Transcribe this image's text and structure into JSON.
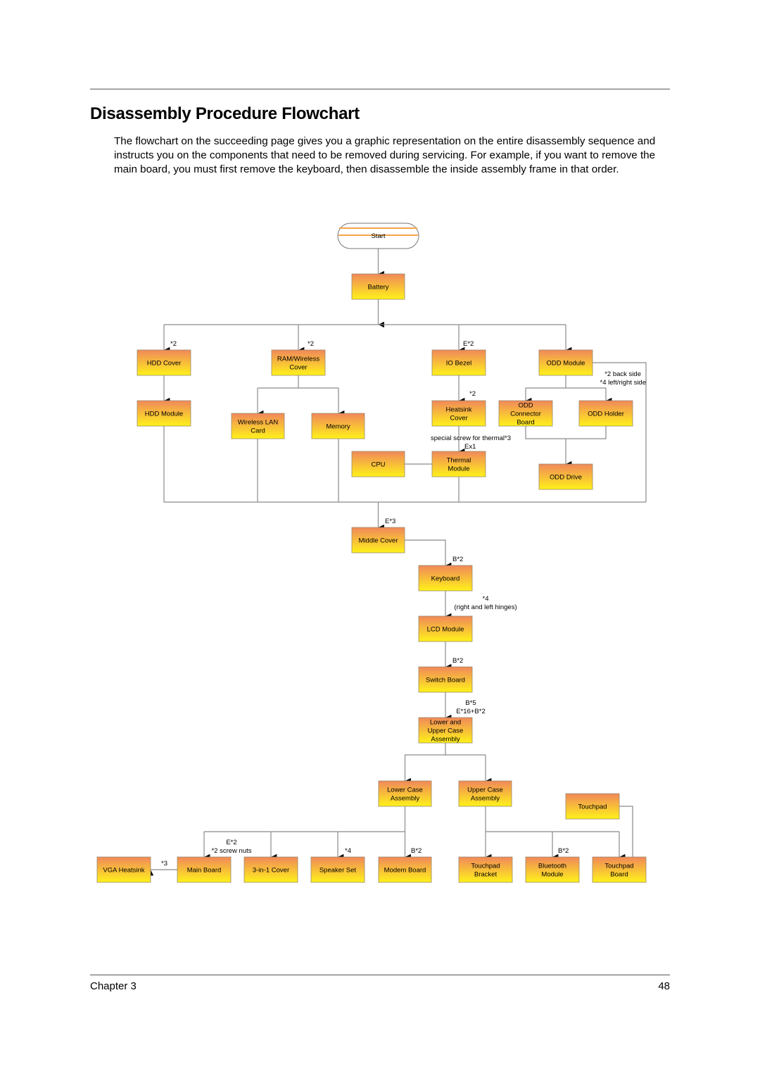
{
  "page": {
    "title": "Disassembly Procedure Flowchart",
    "intro": "The flowchart on the succeeding page gives you a graphic representation on the entire disassembly sequence and instructs you on the components that need to be removed during servicing. For example, if you want to remove the main board, you must first remove the keyboard, then disassemble the inside assembly frame in that order.",
    "footer": {
      "chapter": "Chapter 3",
      "page_number": "48"
    }
  },
  "colors": {
    "box_top": "#f0885a",
    "box_bottom": "#fff21a",
    "line": "#8a8a8a",
    "start_stripe": "#f5a54a"
  },
  "flowchart": {
    "start": "Start",
    "nodes": {
      "battery": [
        "Battery"
      ],
      "hdd_cover": [
        "HDD Cover"
      ],
      "ram_cover": [
        "RAM/Wireless",
        "Cover"
      ],
      "io_bezel": [
        "IO Bezel"
      ],
      "odd_module": [
        "ODD Module"
      ],
      "hdd_module": [
        "HDD Module"
      ],
      "wlan": [
        "Wireless LAN",
        "Card"
      ],
      "memory": [
        "Memory"
      ],
      "heatsink_cover": [
        "Heatsink",
        "Cover"
      ],
      "odd_connector": [
        "ODD",
        "Connector",
        "Board"
      ],
      "odd_holder": [
        "ODD Holder"
      ],
      "cpu": [
        "CPU"
      ],
      "thermal": [
        "Thermal",
        "Module"
      ],
      "odd_drive": [
        "ODD Drive"
      ],
      "middle_cover": [
        "Middle Cover"
      ],
      "keyboard": [
        "Keyboard"
      ],
      "lcd": [
        "LCD Module"
      ],
      "switch_board": [
        "Switch Board"
      ],
      "case_assembly": [
        "Lower and",
        "Upper Case",
        "Assembly"
      ],
      "lower_case": [
        "Lower Case",
        "Assembly"
      ],
      "upper_case": [
        "Upper Case",
        "Assembly"
      ],
      "touchpad": [
        "Touchpad"
      ],
      "vga_heatsink": [
        "VGA Heatsink"
      ],
      "main_board": [
        "Main Board"
      ],
      "cover_3in1": [
        "3-in-1 Cover"
      ],
      "speaker": [
        "Speaker Set"
      ],
      "modem": [
        "Modem Board"
      ],
      "touchpad_bracket": [
        "Touchpad",
        "Bracket"
      ],
      "bluetooth": [
        "Bluetooth",
        "Module"
      ],
      "touchpad_board": [
        "Touchpad",
        "Board"
      ]
    },
    "annotations": {
      "hdd_cover": "*2",
      "ram_cover": "*2",
      "io_bezel": "E*2",
      "odd_notes": [
        "*2 back side",
        "*4 left/right side"
      ],
      "heatsink_cover": "*2",
      "thermal_note": "special screw for thermal*3",
      "thermal_ex": "Ex1",
      "middle_cover": "E*3",
      "keyboard": "B*2",
      "lcd": [
        "*4",
        "(right and left hinges)"
      ],
      "switch_board": "B*2",
      "case_assembly": [
        "B*5",
        "E*16+B*2"
      ],
      "vga": "*3",
      "main_board": [
        "E*2",
        "*2 screw nuts"
      ],
      "speaker": "*4",
      "modem": "B*2",
      "bluetooth": "B*2"
    }
  }
}
